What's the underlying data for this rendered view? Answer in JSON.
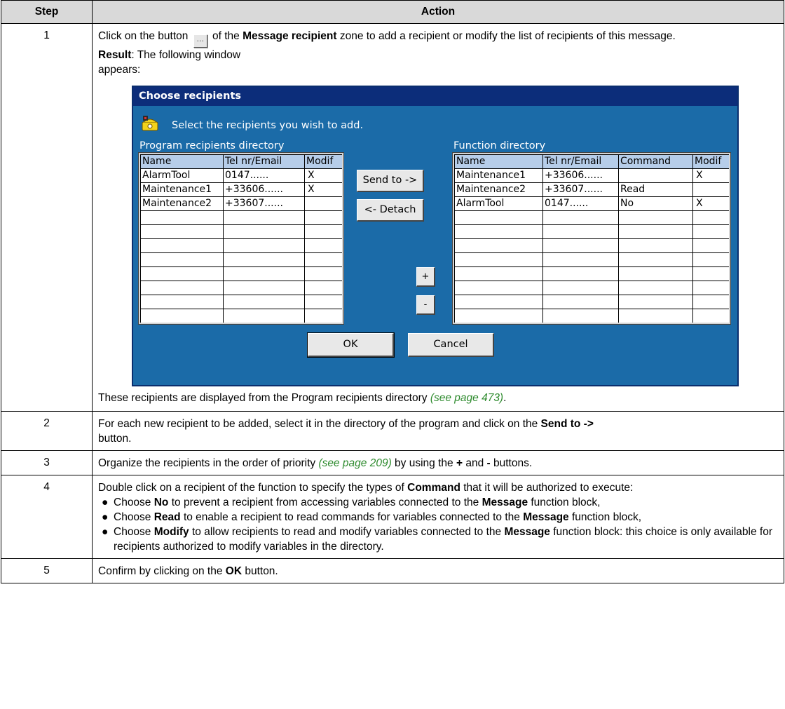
{
  "headers": {
    "step": "Step",
    "action": "Action"
  },
  "row1": {
    "step": "1",
    "intro_pre": "Click on the button",
    "intro_mid": "of the",
    "intro_bold": "Message recipient",
    "intro_post": "zone to add a recipient or modify the list of recipients of this message.",
    "result_label": "Result",
    "result_text": ": The following window",
    "result_text2": "appears:",
    "outro_pre": "These recipients are displayed from the Program recipients directory ",
    "outro_ref": "(see page 473)",
    "outro_post": "."
  },
  "dialog": {
    "title": "Choose recipients",
    "message": "Select the recipients you wish to add.",
    "left_label": "Program recipients directory",
    "right_label": "Function directory",
    "left_headers": [
      "Name",
      "Tel nr/Email",
      "Modif"
    ],
    "left_rows": [
      [
        "AlarmTool",
        "0147......",
        "X"
      ],
      [
        "Maintenance1",
        "+33606......",
        "X"
      ],
      [
        "Maintenance2",
        "+33607......",
        ""
      ]
    ],
    "right_headers": [
      "Name",
      "Tel nr/Email",
      "Command",
      "Modif"
    ],
    "right_rows": [
      [
        "Maintenance1",
        "+33606......",
        "",
        "X"
      ],
      [
        "Maintenance2",
        "+33607......",
        "Read",
        ""
      ],
      [
        "AlarmTool",
        "0147......",
        "No",
        "X"
      ]
    ],
    "send_to": "Send to ->",
    "detach": "<- Detach",
    "plus": "+",
    "minus": "-",
    "ok": "OK",
    "cancel": "Cancel"
  },
  "row2": {
    "step": "2",
    "pre": "For each new recipient to be added, select it in the directory of the program and click on the ",
    "bold": "Send to ->",
    "post": "button."
  },
  "row3": {
    "step": "3",
    "pre": "Organize the recipients in the order of priority ",
    "ref": "(see page 209)",
    "mid1": " by using the ",
    "plus": "+",
    "mid2": " and ",
    "minus": "-",
    "post": " buttons."
  },
  "row4": {
    "step": "4",
    "pre": "Double click on a recipient of the function to specify the types of ",
    "bold": "Command",
    "post": " that it will be authorized to execute:",
    "b1_a": "Choose ",
    "b1_b": "No",
    "b1_c": " to prevent a recipient from accessing variables connected to the ",
    "b1_d": "Message",
    "b1_e": " function block,",
    "b2_a": "Choose ",
    "b2_b": "Read",
    "b2_c": " to enable a recipient to read commands for variables connected to the ",
    "b2_d": "Message",
    "b2_e": " function block,",
    "b3_a": "Choose ",
    "b3_b": "Modify",
    "b3_c": " to allow recipients to read and modify variables connected to the ",
    "b3_d": "Message",
    "b3_e": " function block: this choice is only available for recipients authorized to modify variables in the directory."
  },
  "row5": {
    "step": "5",
    "pre": "Confirm by clicking on the ",
    "bold": "OK",
    "post": " button."
  }
}
